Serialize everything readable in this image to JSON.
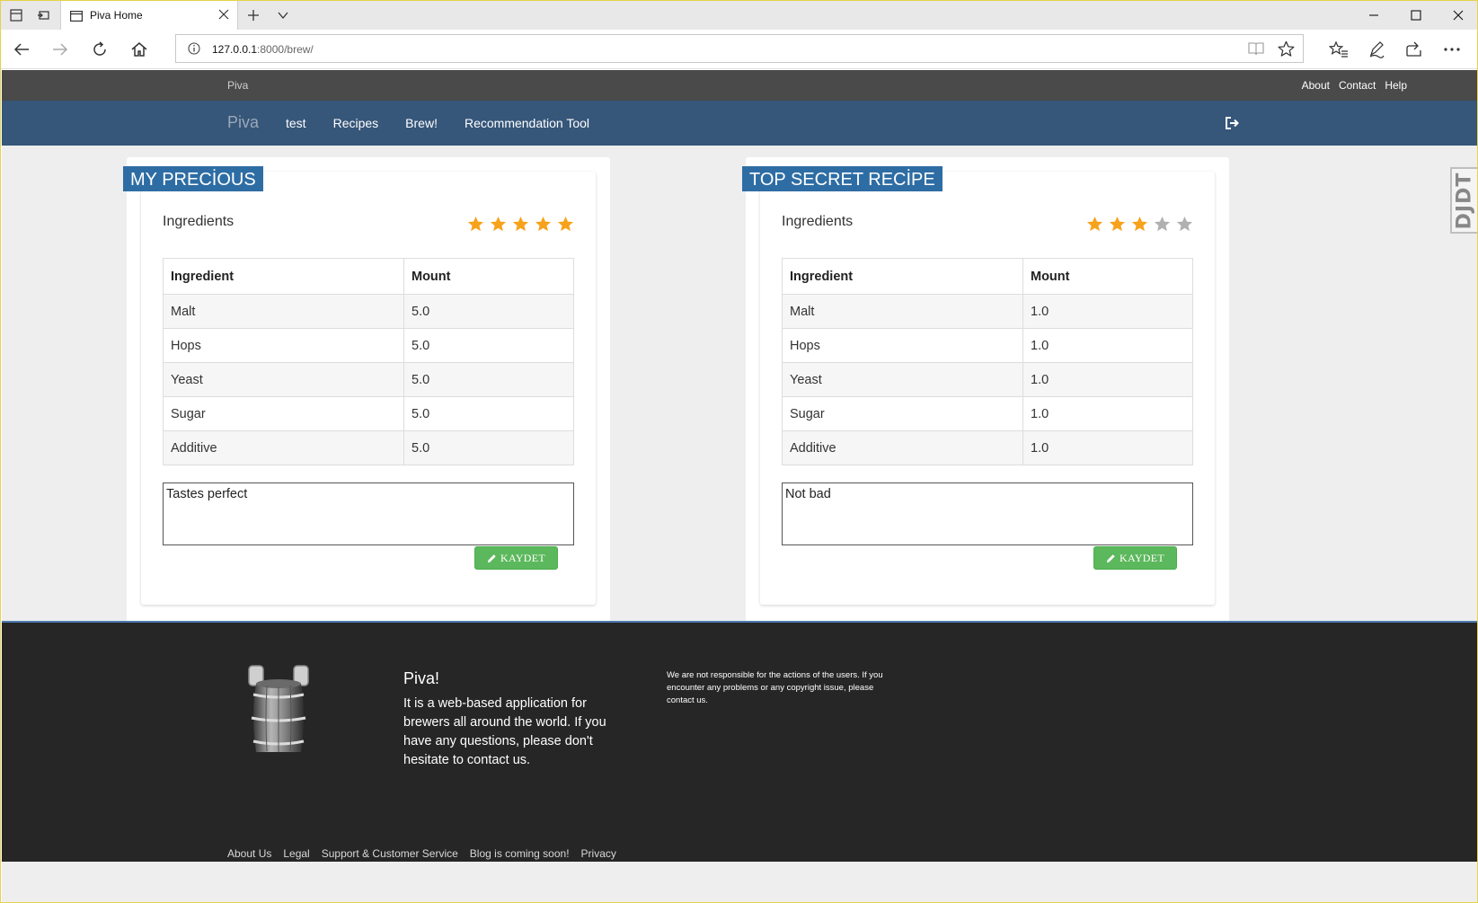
{
  "browser": {
    "tab_title": "Piva Home",
    "url_host": "127.0.0.1",
    "url_rest": ":8000/brew/"
  },
  "topbar": {
    "brand": "Piva",
    "links": [
      "About",
      "Contact",
      "Help"
    ]
  },
  "navbar": {
    "brand": "Piva",
    "items": [
      "test",
      "Recipes",
      "Brew!",
      "Recommendation Tool"
    ]
  },
  "side_widget": {
    "label": "DJDT"
  },
  "recipes": [
    {
      "title": "MY PRECİOUS",
      "ingredients_label": "Ingredients",
      "rating": 5,
      "rating_max": 5,
      "table": {
        "headers": [
          "Ingredient",
          "Mount"
        ],
        "rows": [
          [
            "Malt",
            "5.0"
          ],
          [
            "Hops",
            "5.0"
          ],
          [
            "Yeast",
            "5.0"
          ],
          [
            "Sugar",
            "5.0"
          ],
          [
            "Additive",
            "5.0"
          ]
        ]
      },
      "note": "Tastes perfect",
      "save_label": "KAYDET"
    },
    {
      "title": "TOP SECRET RECİPE",
      "ingredients_label": "Ingredients",
      "rating": 3,
      "rating_max": 5,
      "table": {
        "headers": [
          "Ingredient",
          "Mount"
        ],
        "rows": [
          [
            "Malt",
            "1.0"
          ],
          [
            "Hops",
            "1.0"
          ],
          [
            "Yeast",
            "1.0"
          ],
          [
            "Sugar",
            "1.0"
          ],
          [
            "Additive",
            "1.0"
          ]
        ]
      },
      "note": "Not bad",
      "save_label": "KAYDET"
    }
  ],
  "footer": {
    "title": "Piva!",
    "description": "It is a web-based application for brewers all around the world. If you have any questions, please don't hesitate to contact us.",
    "disclaimer": "We are not responsible for the actions of the users. If you encounter any problems or any copyright issue, please contact us.",
    "links": [
      "About Us",
      "Legal",
      "Support & Customer Service",
      "Blog is coming soon!",
      "Privacy"
    ]
  },
  "colors": {
    "topbar": "#4a4a4a",
    "navbar": "#36567a",
    "title_badge": "#2e6da4",
    "star_on": "#f7a21b",
    "star_off": "#b0b0b0",
    "save_button": "#5cb85c",
    "footer": "#262626"
  }
}
